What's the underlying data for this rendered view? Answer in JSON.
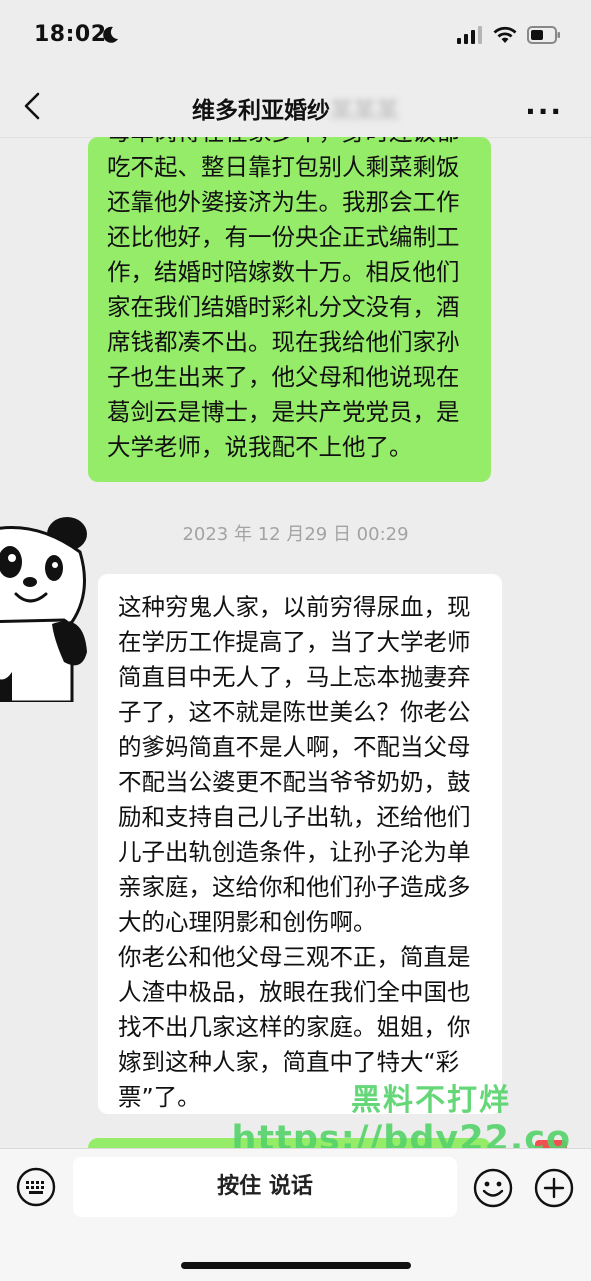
{
  "status_bar": {
    "time": "18:02"
  },
  "nav": {
    "title_visible": "维多利亚婚纱",
    "title_obscured": "某某某"
  },
  "messages": {
    "outgoing_text": "母单岗得在在家多年，身时连饭都吃不起、整日靠打包别人剩菜剩饭还靠他外婆接济为生。我那会工作还比他好，有一份央企正式编制工作，结婚时陪嫁数十万。相反他们家在我们结婚时彩礼分文没有，酒席钱都凑不出。现在我给他们家孙子也生出来了，他父母和他说现在葛剑云是博士，是共产党党员，是大学老师，说我配不上他了。",
    "timestamp": "2023 年 12 月29 日 00:29",
    "incoming_text": "这种穷鬼人家，以前穷得尿血，现在学历工作提高了，当了大学老师简直目中无人了，马上忘本抛妻弃子了，这不就是陈世美么？你老公的爹妈简直不是人啊，不配当父母不配当公婆更不配当爷爷奶奶，鼓励和支持自己儿子出轨，还给他们儿子出轨创造条件，让孙子沦为单亲家庭，这给你和他们孙子造成多大的心理阴影和创伤啊。\n  你老公和他父母三观不正，简直是人渣中极品，放眼在我们全中国也找不出几家这样的家庭。姐姐，你嫁到这种人家，简直中了特大“彩票”了。"
  },
  "watermark": {
    "line1": "黑料不打烊",
    "line2": "https://bdy22.co"
  },
  "input_bar": {
    "hold_to_talk": "按住 说话"
  },
  "colors": {
    "outgoing_bubble": "#95ec69",
    "incoming_bubble": "#ffffff",
    "background": "#ededed"
  }
}
